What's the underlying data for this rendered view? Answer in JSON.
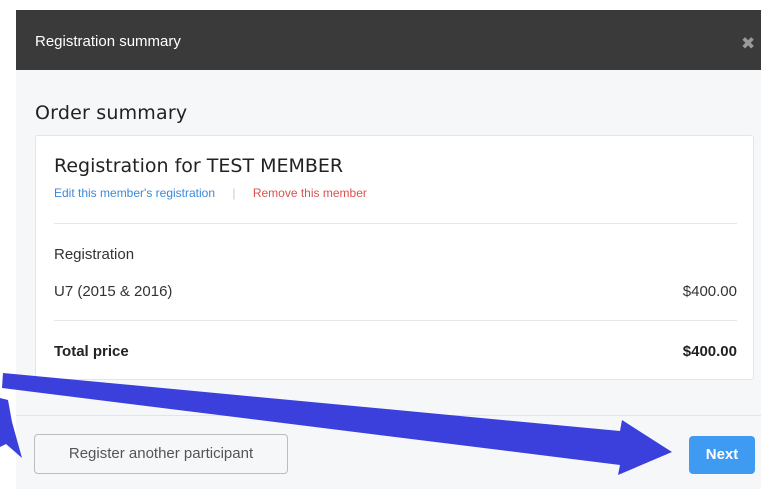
{
  "modal": {
    "title": "Registration summary",
    "close_glyph": "✖"
  },
  "summary": {
    "heading": "Order summary",
    "member_title": "Registration for TEST MEMBER",
    "edit_link": "Edit this member's registration",
    "separator": "|",
    "remove_link": "Remove this member",
    "registration_label": "Registration",
    "item_name": "U7 (2015 & 2016)",
    "item_price": "$400.00",
    "total_label": "Total price",
    "total_price": "$400.00"
  },
  "footer": {
    "register_another_label": "Register another participant",
    "next_label": "Next"
  },
  "colors": {
    "header_bg": "#3a3a3a",
    "primary_button": "#3f9af2",
    "link_blue": "#3d88d8",
    "link_red": "#d9534f",
    "annotation_arrow": "#3b3fdc"
  },
  "icons": {
    "close": "close-icon",
    "arrows": "annotation-arrow"
  }
}
